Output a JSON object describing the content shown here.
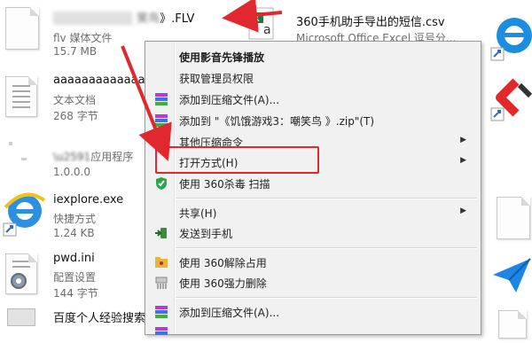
{
  "files_left": [
    {
      "name_prefix": "░░░░░░░░░ 笑鸟",
      "name_suffix": "》.FLV",
      "type": "flv 媒体文件",
      "size": "15.7 MB"
    },
    {
      "name": "aaaaaaaaaaaaa.tx",
      "type": "文本文档",
      "size": "268 字节"
    },
    {
      "name": "",
      "type": "应用程序",
      "size": "1.0.0.0"
    },
    {
      "name": "iexplore.exe",
      "type": "快捷方式",
      "size": "1.24 KB"
    },
    {
      "name": "pwd.ini",
      "type": "配置设置",
      "size": "144 字节"
    },
    {
      "name": "百度个人经验搜索...",
      "type": "",
      "size": ""
    }
  ],
  "file_right": {
    "name": "360手机助手导出的短信.csv",
    "type": "Microsoft Office Excel 逗号分..."
  },
  "context_menu": {
    "items": [
      {
        "label": "使用影音先锋播放",
        "bold": true
      },
      {
        "label": "获取管理员权限"
      },
      {
        "label": "添加到压缩文件(A)..."
      },
      {
        "label": "添加到 \"《饥饿游戏3：嘲笑鸟 》.zip\"(T)"
      },
      {
        "label": "其他压缩命令"
      },
      {
        "label": "打开方式(H)"
      },
      {
        "label": "使用 360杀毒 扫描"
      },
      {
        "label": "共享(H)"
      },
      {
        "label": "发送到手机"
      },
      {
        "label": "使用 360解除占用"
      },
      {
        "label": "使用 360强力删除"
      },
      {
        "label": "添加到压缩文件(A)..."
      }
    ]
  },
  "colors": {
    "highlight": "#e0282e",
    "menu_bg": "#f1f1f1"
  }
}
